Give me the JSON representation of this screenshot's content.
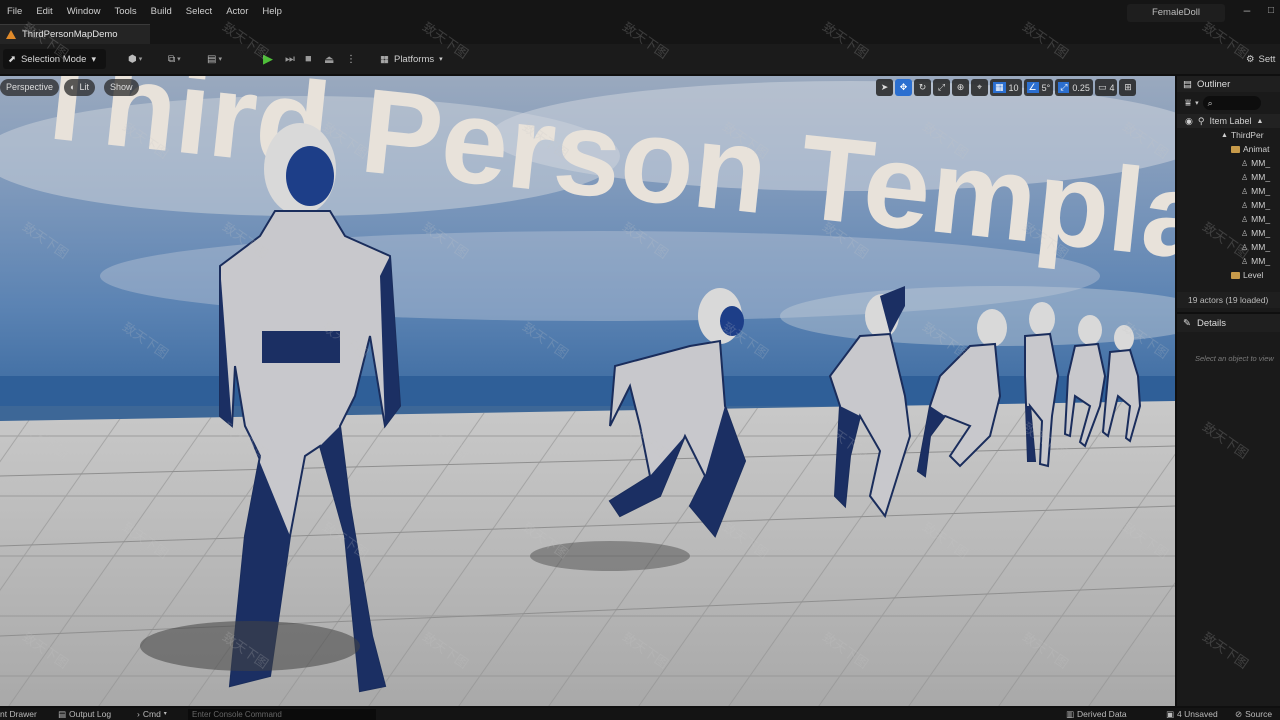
{
  "menubar": {
    "items": [
      "File",
      "Edit",
      "Window",
      "Tools",
      "Build",
      "Select",
      "Actor",
      "Help"
    ],
    "project_name": "FemaleDoll",
    "minimize_icon": "minimize-icon",
    "maximize_icon": "maximize-icon"
  },
  "tab": {
    "level_name": "ThirdPersonMapDemo"
  },
  "toolbar": {
    "mode_label": "Selection Mode",
    "platforms_label": "Platforms",
    "settings_label": "Sett"
  },
  "viewport": {
    "perspective_label": "Perspective",
    "lit_label": "Lit",
    "show_label": "Show",
    "grid_snap_value": "10",
    "rotation_snap_value": "5°",
    "scale_snap_value": "0.25",
    "camera_speed_value": "4",
    "scene_text": "Third Person Template",
    "accent_color": "#2b6fd0"
  },
  "outliner": {
    "title": "Outliner",
    "column_header": "Item Label",
    "tree": [
      {
        "label": "ThirdPer",
        "icon": "level-icon",
        "depth": 0
      },
      {
        "label": "Animat",
        "icon": "folder-icon",
        "depth": 1
      },
      {
        "label": "MM_",
        "icon": "person-icon",
        "depth": 2
      },
      {
        "label": "MM_",
        "icon": "person-icon",
        "depth": 2
      },
      {
        "label": "MM_",
        "icon": "person-icon",
        "depth": 2
      },
      {
        "label": "MM_",
        "icon": "person-icon",
        "depth": 2
      },
      {
        "label": "MM_",
        "icon": "person-icon",
        "depth": 2
      },
      {
        "label": "MM_",
        "icon": "person-icon",
        "depth": 2
      },
      {
        "label": "MM_",
        "icon": "person-icon",
        "depth": 2
      },
      {
        "label": "MM_",
        "icon": "person-icon",
        "depth": 2
      },
      {
        "label": "Level",
        "icon": "folder-icon",
        "depth": 1
      }
    ],
    "actor_count": "19 actors (19 loaded)"
  },
  "details": {
    "title": "Details",
    "hint": "Select an object to view"
  },
  "statusbar": {
    "content_drawer": "nt Drawer",
    "output_log": "Output Log",
    "cmd": "Cmd",
    "console_placeholder": "Enter Console Command",
    "derived_data": "Derived Data",
    "unsaved": "4 Unsaved",
    "source": "Source"
  },
  "watermark": "致天下图"
}
